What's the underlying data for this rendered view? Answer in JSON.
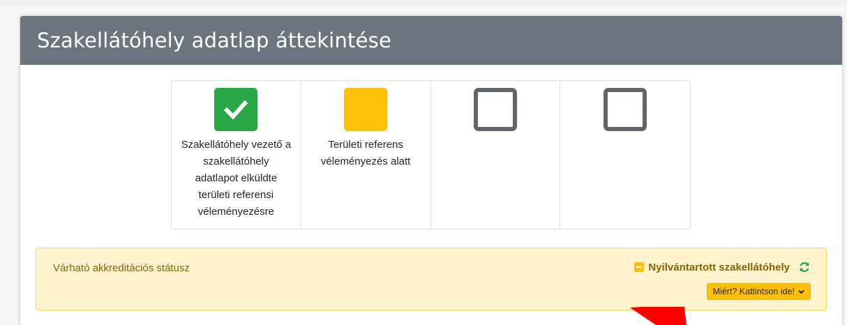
{
  "card": {
    "title": "Szakellátóhely adatlap áttekintése"
  },
  "steps": [
    {
      "state": "done",
      "icon": "check-icon",
      "label": "Szakellátóhely vezető a szakellátóhely adatlapot elküldte területi referensi véleményezésre"
    },
    {
      "state": "in-progress",
      "icon": "pending-square-icon",
      "label": "Területi referens véleményezés alatt"
    },
    {
      "state": "empty",
      "icon": "empty-square-icon",
      "label": ""
    },
    {
      "state": "empty",
      "icon": "empty-square-icon",
      "label": ""
    }
  ],
  "alert": {
    "label": "Várható akkreditációs státusz",
    "status_text": "Nyilvántartott szakellátóhely",
    "status_icon": "minus-square-icon",
    "refresh_icon": "refresh-icon",
    "why_button_label": "Miért? Kattintson ide!",
    "why_button_icon": "chevron-down-icon"
  },
  "colors": {
    "header_bg": "#6c757d",
    "done": "#28a745",
    "in_progress": "#ffc107",
    "empty_border": "#5f656b",
    "alert_bg": "#fff3cd",
    "alert_text": "#856404",
    "arrow": "#ff0000"
  }
}
